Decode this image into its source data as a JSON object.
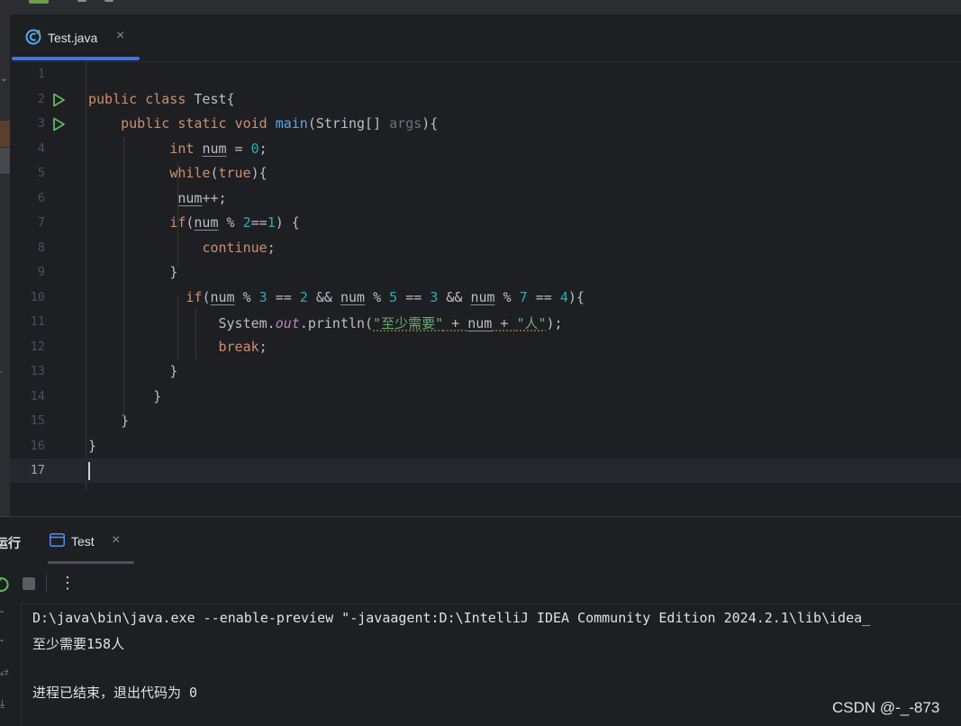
{
  "editor": {
    "tab": {
      "filename": "Test.java",
      "close": "×",
      "icon": "java-class-icon",
      "accent": "#3574f0"
    },
    "line_numbers": [
      "1",
      "2",
      "3",
      "4",
      "5",
      "6",
      "7",
      "8",
      "9",
      "10",
      "11",
      "12",
      "13",
      "14",
      "15",
      "16",
      "17"
    ],
    "current_line": "17",
    "run_gutter_lines": [
      "2",
      "3"
    ],
    "code": {
      "l2": {
        "public": "public",
        "class": "class",
        "name": "Test",
        "brace": "{"
      },
      "l3": {
        "public": "public",
        "static": "static",
        "void": "void",
        "main": "main",
        "params_a": "(String[] ",
        "args": "args",
        "params_b": "){"
      },
      "l4": {
        "type": "int",
        "var": "num",
        "eq": " = ",
        "val": "0",
        "semi": ";"
      },
      "l5": {
        "kw": "while",
        "open": "(",
        "val": "true",
        "close": "){"
      },
      "l6": {
        "var": "num",
        "op": "++;"
      },
      "l7": {
        "kw": "if",
        "open": "(",
        "var": "num",
        "mod": " % ",
        "n2": "2",
        "eqeq": "==",
        "n1": "1",
        "close": ") {"
      },
      "l8": {
        "kw": "continue",
        "semi": ";"
      },
      "l9": {
        "brace": "}"
      },
      "l10": {
        "kw": "if",
        "open": "(",
        "v1": "num",
        "m1": " % ",
        "a": "3",
        "e1": " == ",
        "b": "2",
        "and1": " && ",
        "v2": "num",
        "m2": " % ",
        "c": "5",
        "e2": " == ",
        "d": "3",
        "and2": " && ",
        "v3": "num",
        "m3": " % ",
        "e": "7",
        "e3": " == ",
        "f": "4",
        "close": "){"
      },
      "l11": {
        "sys": "System.",
        "out": "out",
        "println": ".println(",
        "s1": "\"至少需要\"",
        "plus1": " + ",
        "var": "num",
        "plus2": " + ",
        "s2": "\"人\"",
        "end": ");"
      },
      "l12": {
        "kw": "break",
        "semi": ";"
      },
      "l13": {
        "brace": "}"
      },
      "l14": {
        "brace": "}"
      },
      "l15": {
        "brace": "}"
      },
      "l16": {
        "brace": "}"
      }
    }
  },
  "run_panel": {
    "title": "运行",
    "tab": {
      "label": "Test",
      "close": "×",
      "icon": "console-icon"
    },
    "toolbar": {
      "rerun_icon": "rerun-icon",
      "stop_icon": "stop-icon",
      "more": "⋮"
    },
    "console_lines": [
      "D:\\java\\bin\\java.exe --enable-preview \"-javaagent:D:\\IntelliJ IDEA Community Edition 2024.2.1\\lib\\idea_",
      "至少需要158人",
      "",
      "进程已结束，退出代码为 0"
    ]
  },
  "watermark": "CSDN @-_-873",
  "colors": {
    "background": "#1e1f22",
    "keyword": "#cf8e6d",
    "function": "#56a8f5",
    "number": "#2aacb8",
    "string": "#6aab73",
    "static_field": "#c77dbb",
    "run_arrow": "#5fb865"
  }
}
